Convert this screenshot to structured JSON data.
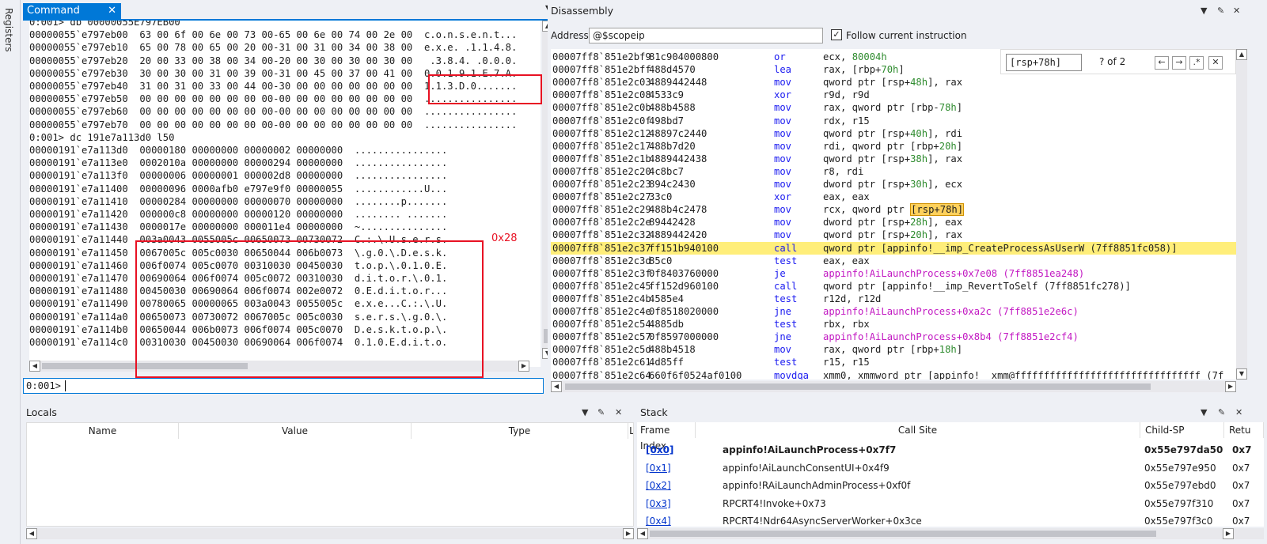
{
  "registers_tab": "Registers",
  "command": {
    "tab_title": "Command",
    "prompt": "0:001>",
    "annotation": "0x28",
    "db_lines": [
      "0:001> db 00000055E797EB00",
      "00000055`e797eb00  63 00 6f 00 6e 00 73 00-65 00 6e 00 74 00 2e 00  c.o.n.s.e.n.t...",
      "00000055`e797eb10  65 00 78 00 65 00 20 00-31 00 31 00 34 00 38 00  e.x.e. .1.1.4.8.",
      "00000055`e797eb20  20 00 33 00 38 00 34 00-20 00 30 00 30 00 30 00   .3.8.4. .0.0.0.",
      "00000055`e797eb30  30 00 30 00 31 00 39 00-31 00 45 00 37 00 41 00  0.0.1.9.1.E.7.A.",
      "00000055`e797eb40  31 00 31 00 33 00 44 00-30 00 00 00 00 00 00 00  1.1.3.D.0.......",
      "00000055`e797eb50  00 00 00 00 00 00 00 00-00 00 00 00 00 00 00 00  ................",
      "00000055`e797eb60  00 00 00 00 00 00 00 00-00 00 00 00 00 00 00 00  ................",
      "00000055`e797eb70  00 00 00 00 00 00 00 00-00 00 00 00 00 00 00 00  ................"
    ],
    "dc_lines": [
      "0:001> dc 191e7a113d0 l50",
      "00000191`e7a113d0  00000180 00000000 00000002 00000000  ................",
      "00000191`e7a113e0  0002010a 00000000 00000294 00000000  ................",
      "00000191`e7a113f0  00000006 00000001 000002d8 00000000  ................",
      "00000191`e7a11400  00000096 0000afb0 e797e9f0 00000055  ............U...",
      "00000191`e7a11410  00000284 00000000 00000070 00000000  ........p.......",
      "00000191`e7a11420  000000c8 00000000 00000120 00000000  ........ .......",
      "00000191`e7a11430  0000017e 00000000 000011e4 00000000  ~...............",
      "00000191`e7a11440  003a0043 0055005c 00650073 00730072  C.:.\\.U.s.e.r.s.",
      "00000191`e7a11450  0067005c 005c0030 00650044 006b0073  \\.g.0.\\.D.e.s.k.",
      "00000191`e7a11460  006f0074 005c0070 00310030 00450030  t.o.p.\\.0.1.0.E.",
      "00000191`e7a11470  00690064 006f0074 005c0072 00310030  d.i.t.o.r.\\.0.1.",
      "00000191`e7a11480  00450030 00690064 006f0074 002e0072  0.E.d.i.t.o.r...",
      "00000191`e7a11490  00780065 00000065 003a0043 0055005c  e.x.e...C.:.\\.U.",
      "00000191`e7a114a0  00650073 00730072 0067005c 005c0030  s.e.r.s.\\.g.0.\\.",
      "00000191`e7a114b0  00650044 006b0073 006f0074 005c0070  D.e.s.k.t.o.p.\\.",
      "00000191`e7a114c0  00310030 00450030 00690064 006f0074  0.1.0.E.d.i.t.o."
    ]
  },
  "disassembly": {
    "title": "Disassembly",
    "address_label": "Address:",
    "address_value": "@$scopeip",
    "follow_label": "Follow current instruction",
    "search_value": "[rsp+78h]",
    "search_count": "? of 2",
    "rows": [
      {
        "addr": "00007ff8`851e2bf9",
        "bytes": "81c904000800",
        "mn": "or",
        "ops": [
          [
            "ecx, ",
            ""
          ],
          [
            "80004h",
            "grn"
          ]
        ]
      },
      {
        "addr": "00007ff8`851e2bff",
        "bytes": "488d4570",
        "mn": "lea",
        "ops": [
          [
            "rax, [rbp+",
            ""
          ],
          [
            "70h",
            "grn"
          ],
          [
            "]",
            ""
          ]
        ]
      },
      {
        "addr": "00007ff8`851e2c03",
        "bytes": "4889442448",
        "mn": "mov",
        "ops": [
          [
            "qword ptr [rsp+",
            ""
          ],
          [
            "48h",
            "grn"
          ],
          [
            "], rax",
            ""
          ]
        ]
      },
      {
        "addr": "00007ff8`851e2c08",
        "bytes": "4533c9",
        "mn": "xor",
        "ops": [
          [
            "r9d, r9d",
            ""
          ]
        ]
      },
      {
        "addr": "00007ff8`851e2c0b",
        "bytes": "488b4588",
        "mn": "mov",
        "ops": [
          [
            "rax, qword ptr [rbp-",
            ""
          ],
          [
            "78h",
            "grn"
          ],
          [
            "]",
            ""
          ]
        ]
      },
      {
        "addr": "00007ff8`851e2c0f",
        "bytes": "498bd7",
        "mn": "mov",
        "ops": [
          [
            "rdx, r15",
            ""
          ]
        ]
      },
      {
        "addr": "00007ff8`851e2c12",
        "bytes": "48897c2440",
        "mn": "mov",
        "ops": [
          [
            "qword ptr [rsp+",
            ""
          ],
          [
            "40h",
            "grn"
          ],
          [
            "], rdi",
            ""
          ]
        ]
      },
      {
        "addr": "00007ff8`851e2c17",
        "bytes": "488b7d20",
        "mn": "mov",
        "ops": [
          [
            "rdi, qword ptr [rbp+",
            ""
          ],
          [
            "20h",
            "grn"
          ],
          [
            "]",
            ""
          ]
        ]
      },
      {
        "addr": "00007ff8`851e2c1b",
        "bytes": "4889442438",
        "mn": "mov",
        "ops": [
          [
            "qword ptr [rsp+",
            ""
          ],
          [
            "38h",
            "grn"
          ],
          [
            "], rax",
            ""
          ]
        ]
      },
      {
        "addr": "00007ff8`851e2c20",
        "bytes": "4c8bc7",
        "mn": "mov",
        "ops": [
          [
            "r8, rdi",
            ""
          ]
        ]
      },
      {
        "addr": "00007ff8`851e2c23",
        "bytes": "894c2430",
        "mn": "mov",
        "ops": [
          [
            "dword ptr [rsp+",
            ""
          ],
          [
            "30h",
            "grn"
          ],
          [
            "], ecx",
            ""
          ]
        ]
      },
      {
        "addr": "00007ff8`851e2c27",
        "bytes": "33c0",
        "mn": "xor",
        "ops": [
          [
            "eax, eax",
            ""
          ]
        ]
      },
      {
        "addr": "00007ff8`851e2c29",
        "bytes": "488b4c2478",
        "mn": "mov",
        "ops": [
          [
            "rcx, qword ptr ",
            ""
          ],
          [
            "[rsp+78h]",
            "hl"
          ]
        ]
      },
      {
        "addr": "00007ff8`851e2c2e",
        "bytes": "89442428",
        "mn": "mov",
        "ops": [
          [
            "dword ptr [rsp+",
            ""
          ],
          [
            "28h",
            "grn"
          ],
          [
            "], eax",
            ""
          ]
        ]
      },
      {
        "addr": "00007ff8`851e2c32",
        "bytes": "4889442420",
        "mn": "mov",
        "ops": [
          [
            "qword ptr [rsp+",
            ""
          ],
          [
            "20h",
            "grn"
          ],
          [
            "], rax",
            ""
          ]
        ]
      },
      {
        "addr": "00007ff8`851e2c37",
        "bytes": "ff151b940100",
        "mn": "call",
        "ops": [
          [
            "qword ptr [appinfo!__imp_CreateProcessAsUserW (7ff8851fc058)]",
            ""
          ]
        ],
        "current": true
      },
      {
        "addr": "00007ff8`851e2c3d",
        "bytes": "85c0",
        "mn": "test",
        "ops": [
          [
            "eax, eax",
            ""
          ]
        ]
      },
      {
        "addr": "00007ff8`851e2c3f",
        "bytes": "0f8403760000",
        "mn": "je",
        "ops": [
          [
            "appinfo!AiLaunchProcess+0x7e08 (7ff8851ea248)",
            "mag"
          ]
        ]
      },
      {
        "addr": "00007ff8`851e2c45",
        "bytes": "ff152d960100",
        "mn": "call",
        "ops": [
          [
            "qword ptr [appinfo!__imp_RevertToSelf (7ff8851fc278)]",
            ""
          ]
        ]
      },
      {
        "addr": "00007ff8`851e2c4b",
        "bytes": "4585e4",
        "mn": "test",
        "ops": [
          [
            "r12d, r12d",
            ""
          ]
        ]
      },
      {
        "addr": "00007ff8`851e2c4e",
        "bytes": "0f8518020000",
        "mn": "jne",
        "ops": [
          [
            "appinfo!AiLaunchProcess+0xa2c (7ff8851e2e6c)",
            "mag"
          ]
        ]
      },
      {
        "addr": "00007ff8`851e2c54",
        "bytes": "4885db",
        "mn": "test",
        "ops": [
          [
            "rbx, rbx",
            ""
          ]
        ]
      },
      {
        "addr": "00007ff8`851e2c57",
        "bytes": "0f8597000000",
        "mn": "jne",
        "ops": [
          [
            "appinfo!AiLaunchProcess+0x8b4 (7ff8851e2cf4)",
            "mag"
          ]
        ]
      },
      {
        "addr": "00007ff8`851e2c5d",
        "bytes": "488b4518",
        "mn": "mov",
        "ops": [
          [
            "rax, qword ptr [rbp+",
            ""
          ],
          [
            "18h",
            "grn"
          ],
          [
            "]",
            ""
          ]
        ]
      },
      {
        "addr": "00007ff8`851e2c61",
        "bytes": "4d85ff",
        "mn": "test",
        "ops": [
          [
            "r15, r15",
            ""
          ]
        ]
      },
      {
        "addr": "00007ff8`851e2c64",
        "bytes": "660f6f0524af0100",
        "mn": "movdqa",
        "ops": [
          [
            "xmm0, xmmword ptr [appinfo!  xmm@ffffffffffffffffffffffffffffffff (7f",
            ""
          ]
        ]
      }
    ]
  },
  "locals": {
    "title": "Locals",
    "columns": [
      "Name",
      "Value",
      "Type",
      "L"
    ]
  },
  "stack": {
    "title": "Stack",
    "columns": [
      "Frame Index",
      "Call Site",
      "Child-SP",
      "Retu"
    ],
    "rows": [
      {
        "idx": "[0x0]",
        "site": "appinfo!AiLaunchProcess+0x7f7",
        "sp": "0x55e797da50",
        "ret": "0x7",
        "bold": true
      },
      {
        "idx": "[0x1]",
        "site": "appinfo!AiLaunchConsentUI+0x4f9",
        "sp": "0x55e797e950",
        "ret": "0x7"
      },
      {
        "idx": "[0x2]",
        "site": "appinfo!RAiLaunchAdminProcess+0xf0f",
        "sp": "0x55e797ebd0",
        "ret": "0x7"
      },
      {
        "idx": "[0x3]",
        "site": "RPCRT4!Invoke+0x73",
        "sp": "0x55e797f310",
        "ret": "0x7"
      },
      {
        "idx": "[0x4]",
        "site": "RPCRT4!Ndr64AsyncServerWorker+0x3ce",
        "sp": "0x55e797f3c0",
        "ret": "0x7"
      }
    ]
  },
  "colors": {
    "accent": "#0078d7",
    "current_line": "#ffee7a",
    "highlight": "#ffd15c",
    "annot_red": "#e81123"
  }
}
